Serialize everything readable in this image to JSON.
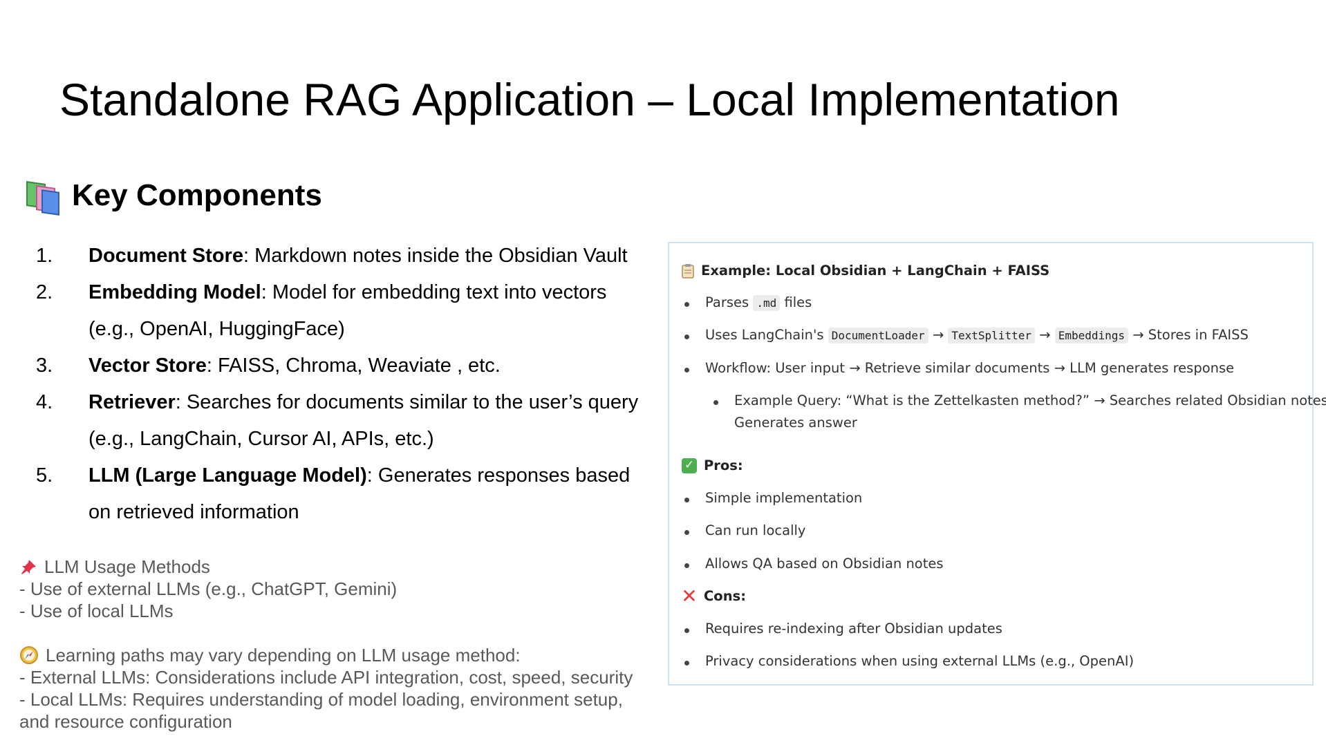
{
  "title": "Standalone RAG Application – Local Implementation",
  "section": {
    "title": "Key Components",
    "icon": "books-icon"
  },
  "components": [
    {
      "num": "1.",
      "term": "Document Store",
      "desc": ": Markdown notes inside the Obsidian Vault"
    },
    {
      "num": "2.",
      "term": "Embedding Model",
      "desc": ": Model for embedding text into vectors (e.g., OpenAI, HuggingFace)"
    },
    {
      "num": "3.",
      "term": "Vector Store",
      "desc": ": FAISS, Chroma, Weaviate , etc."
    },
    {
      "num": "4.",
      "term": "Retriever",
      "desc": ": Searches for documents similar to the user’s query (e.g., LangChain, Cursor AI, APIs, etc.)"
    },
    {
      "num": "5.",
      "term": "LLM (Large Language Model)",
      "desc": ": Generates responses based on retrieved information"
    }
  ],
  "notes": {
    "usage_title": "LLM Usage Methods",
    "usage_lines": [
      "- Use of external LLMs (e.g., ChatGPT, Gemini)",
      "- Use of local LLMs"
    ],
    "paths_title": "Learning paths may vary depending on LLM usage method:",
    "paths_lines": [
      "- External LLMs: Considerations include API integration, cost, speed, security",
      "- Local LLMs: Requires understanding of model loading, environment setup,",
      "and resource configuration"
    ]
  },
  "example_panel": {
    "heading": "Example: Local Obsidian + LangChain + FAISS",
    "parses_prefix": "Parses",
    "parses_code": ".md",
    "parses_suffix": "files",
    "uses_prefix": "Uses LangChain's",
    "uses_code1": "DocumentLoader",
    "arrow": "→",
    "uses_code2": "TextSplitter",
    "uses_code3": "Embeddings",
    "uses_suffix": "→ Stores in FAISS",
    "workflow": "Workflow: User input → Retrieve similar documents → LLM generates response",
    "example_query_line1": "Example Query: “What is the Zettelkasten method?” → Searches related Obsidian notes →",
    "example_query_line2": "Generates answer",
    "pros_label": "Pros:",
    "pros": [
      "Simple implementation",
      "Can run locally",
      "Allows QA based on Obsidian notes"
    ],
    "cons_label": "Cons:",
    "cons": [
      "Requires re-indexing after Obsidian updates",
      "Privacy considerations when using external LLMs (e.g., OpenAI)"
    ]
  }
}
